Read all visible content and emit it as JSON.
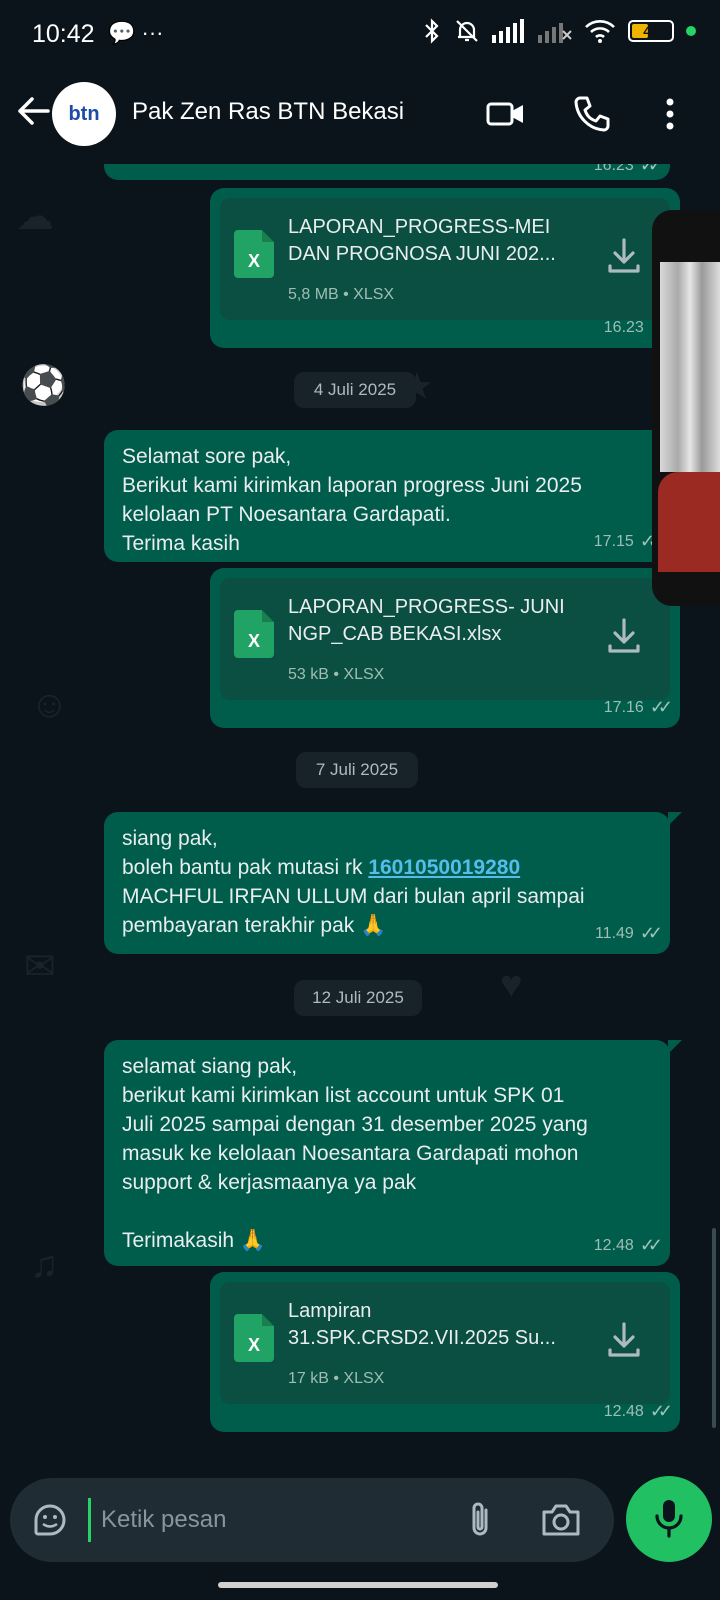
{
  "status": {
    "time": "10:42",
    "battery": "41",
    "battery_level": 0.41
  },
  "header": {
    "contact_name": "Pak Zen Ras BTN Bekasi",
    "avatar_text": "btn"
  },
  "messages": [
    {
      "kind": "file",
      "file_name": "LAPORAN_PROGRESS-MEI DAN PROGNOSA JUNI 202...",
      "file_meta": "5,8 MB • XLSX",
      "time": "16.23"
    },
    {
      "kind": "text",
      "text": "Selamat sore pak,\nBerikut kami kirimkan laporan progress Juni 2025\nkelolaan PT Noesantara Gardapati.\nTerima kasih",
      "time": "17.15"
    },
    {
      "kind": "file",
      "file_name": "LAPORAN_PROGRESS- JUNI NGP_CAB BEKASI.xlsx",
      "file_meta": "53 kB • XLSX",
      "time": "17.16"
    },
    {
      "kind": "text",
      "text_before": "siang pak,\nboleh bantu pak mutasi rk ",
      "link": "1601050019280",
      "text_after": "\nMACHFUL IRFAN ULLUM dari bulan april sampai\npembayaran terakhir pak 🙏",
      "time": "11.49"
    },
    {
      "kind": "text",
      "text": "selamat siang pak,\nberikut kami kirimkan list account untuk SPK 01\nJuli 2025 sampai dengan 31 desember 2025 yang\nmasuk ke kelolaan Noesantara Gardapati mohon\nsupport & kerjasmaanya ya pak\n\nTerimakasih 🙏",
      "time": "12.48"
    },
    {
      "kind": "file",
      "file_name": "Lampiran 31.SPK.CRSD2.VII.2025 Su...",
      "file_meta": "17 kB • XLSX",
      "time": "12.48"
    }
  ],
  "top_partial_time": "16.23",
  "dates": [
    "4 Juli 2025",
    "7 Juli 2025",
    "12 Juli 2025"
  ],
  "input": {
    "placeholder": "Ketik pesan"
  },
  "icons": {
    "xls": "X"
  }
}
